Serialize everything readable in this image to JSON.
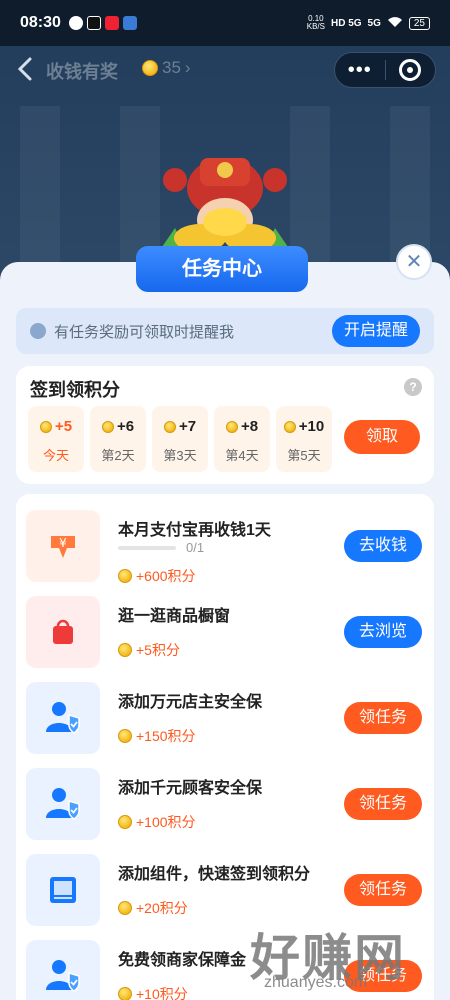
{
  "status": {
    "time": "08:30",
    "speed_top": "0.10",
    "speed_bottom": "KB/S",
    "network_1": "HD 5G",
    "network_2": "5G",
    "battery": "25"
  },
  "nav": {
    "title": "收钱有奖",
    "coins": "35"
  },
  "sheet": {
    "banner": "任务中心",
    "reminder_text": "有任务奖励可领取时提醒我",
    "reminder_button": "开启提醒"
  },
  "checkin": {
    "title": "签到领积分",
    "help": "?",
    "claim_button": "领取",
    "days": [
      {
        "value": "+5",
        "label": "今天"
      },
      {
        "value": "+6",
        "label": "第2天"
      },
      {
        "value": "+7",
        "label": "第3天"
      },
      {
        "value": "+8",
        "label": "第4天"
      },
      {
        "value": "+10",
        "label": "第5天"
      }
    ]
  },
  "tasks": [
    {
      "title": "本月支付宝再收钱1天",
      "reward": "+600积分",
      "button": "去收钱",
      "progress": "0/1",
      "progress_fraction": 0,
      "icon": "yuan-arrow-icon"
    },
    {
      "title": "逛一逛商品橱窗",
      "reward": "+5积分",
      "button": "去浏览",
      "icon": "shopping-bag-icon"
    },
    {
      "title": "添加万元店主安全保",
      "reward": "+150积分",
      "button": "领任务",
      "icon": "user-shield-icon"
    },
    {
      "title": "添加千元顾客安全保",
      "reward": "+100积分",
      "button": "领任务",
      "icon": "user-shield-icon"
    },
    {
      "title": "添加组件，快速签到领积分",
      "reward": "+20积分",
      "button": "领任务",
      "icon": "widget-icon"
    },
    {
      "title": "免费领商家保障金",
      "reward": "+10积分",
      "button": "领任务",
      "icon": "user-shield-icon"
    }
  ],
  "watermark": {
    "main": "好赚网",
    "sub": "zhuanyes.com"
  },
  "colors": {
    "blue": "#1677ff",
    "orange": "#ff5a1f"
  }
}
